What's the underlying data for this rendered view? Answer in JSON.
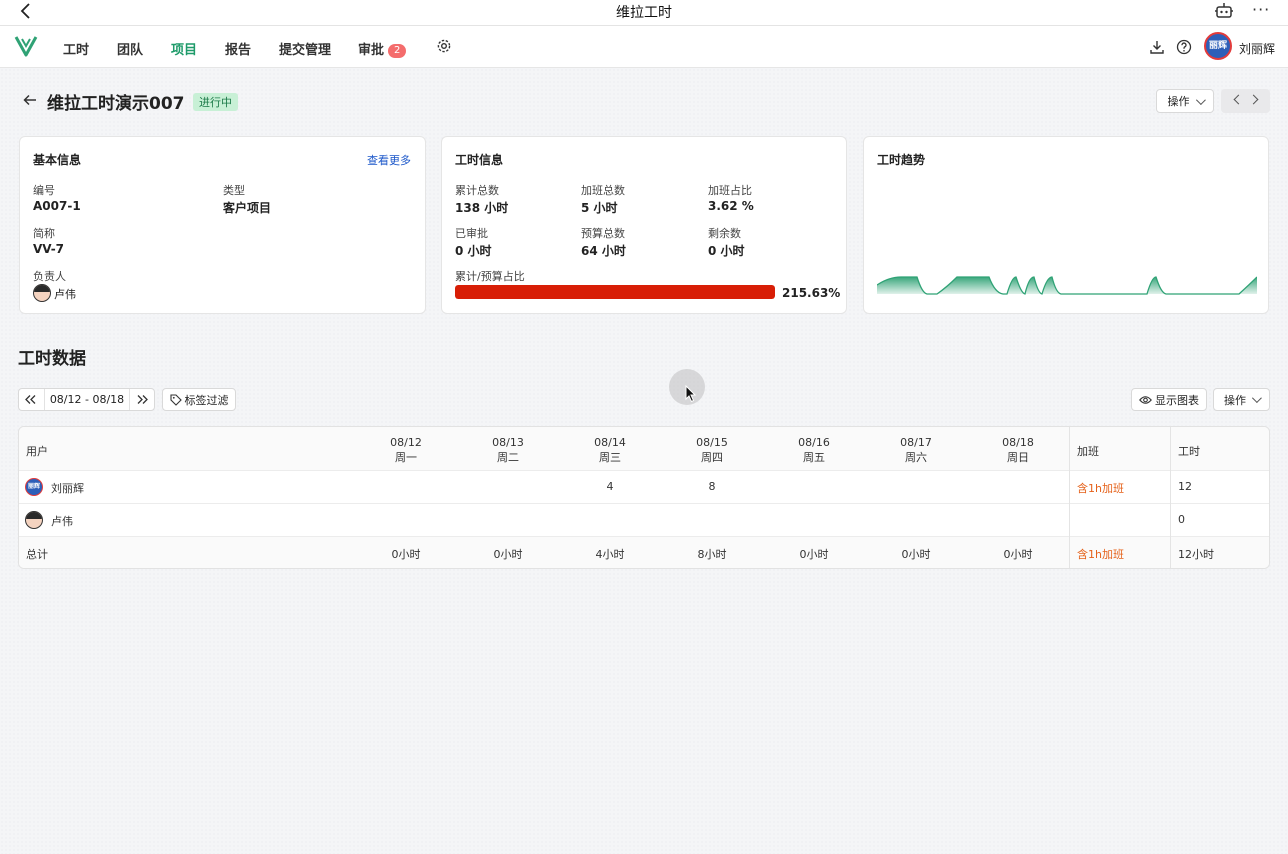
{
  "titlebar": {
    "title": "维拉工时"
  },
  "nav": {
    "items": [
      "工时",
      "团队",
      "项目",
      "报告",
      "提交管理",
      "审批"
    ],
    "approval_badge": "2",
    "user_name": "刘丽辉",
    "avatar_text": "丽辉"
  },
  "project": {
    "title": "维拉工时演示007",
    "status": "进行中",
    "action_label": "操作"
  },
  "basic": {
    "title": "基本信息",
    "more": "查看更多",
    "code_label": "编号",
    "code": "A007-1",
    "type_label": "类型",
    "type": "客户项目",
    "short_label": "简称",
    "short": "VV-7",
    "owner_label": "负责人",
    "owner": "卢伟"
  },
  "hours": {
    "title": "工时信息",
    "total_label": "累计总数",
    "total": "138 小时",
    "overtime_label": "加班总数",
    "overtime": "5 小时",
    "ratio_label": "加班占比",
    "ratio": "3.62 %",
    "approved_label": "已审批",
    "approved": "0 小时",
    "budget_label": "预算总数",
    "budget": "64 小时",
    "remain_label": "剩余数",
    "remain": "0 小时",
    "progress_label": "累计/预算占比",
    "progress_text": "215.63%",
    "progress_fraction": 1.0,
    "progress_color": "#d81e06"
  },
  "trend": {
    "title": "工时趋势",
    "color": "#2fa275"
  },
  "data_section": {
    "title": "工时数据",
    "date_range": "08/12 - 08/18",
    "tag_filter": "标签过滤",
    "show_chart": "显示图表",
    "action_label": "操作"
  },
  "table": {
    "user_header": "用户",
    "days": [
      {
        "date": "08/12",
        "weekday": "周一"
      },
      {
        "date": "08/13",
        "weekday": "周二"
      },
      {
        "date": "08/14",
        "weekday": "周三"
      },
      {
        "date": "08/15",
        "weekday": "周四"
      },
      {
        "date": "08/16",
        "weekday": "周五"
      },
      {
        "date": "08/17",
        "weekday": "周六"
      },
      {
        "date": "08/18",
        "weekday": "周日"
      }
    ],
    "overtime_header": "加班",
    "hours_header": "工时",
    "rows": [
      {
        "user": "刘丽辉",
        "values": [
          "",
          "",
          "4",
          "8",
          "",
          "",
          ""
        ],
        "overtime": "含1h加班",
        "hours": "12"
      },
      {
        "user": "卢伟",
        "values": [
          "",
          "",
          "",
          "",
          "",
          "",
          ""
        ],
        "overtime": "",
        "hours": "0"
      }
    ],
    "total": {
      "label": "总计",
      "values": [
        "0小时",
        "0小时",
        "4小时",
        "8小时",
        "0小时",
        "0小时",
        "0小时"
      ],
      "overtime": "含1h加班",
      "hours": "12小时"
    }
  }
}
